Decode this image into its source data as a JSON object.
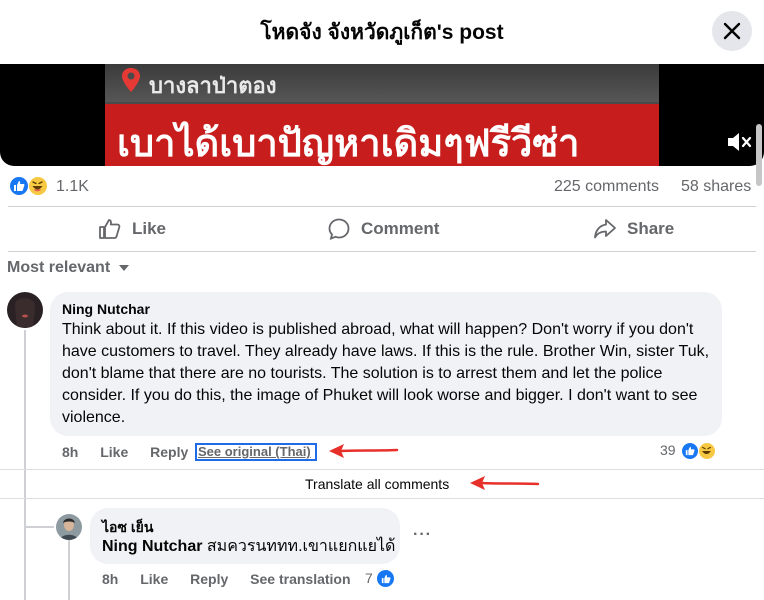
{
  "header": {
    "title": "โหดจัง จังหวัดภูเก็ต's post",
    "close_icon": "close-icon"
  },
  "video": {
    "location_text": "บางลาป่าตอง",
    "caption": "เบาได้เบาปัญหาเดิมๆฟรีวีซ่า",
    "mute_icon": "volume-muted-icon"
  },
  "stats": {
    "reactions": "1.1K",
    "comments": "225 comments",
    "shares": "58 shares"
  },
  "actions": {
    "like": "Like",
    "comment": "Comment",
    "share": "Share"
  },
  "sort": {
    "label": "Most relevant"
  },
  "comment1": {
    "author": "Ning Nutchar",
    "text": "Think about it. If this video is published abroad, what will happen? Don't worry if you don't have customers to travel. They already have laws. If this is the rule. Brother Win, sister Tuk, don't blame that there are no tourists. The solution is to arrest them and let the police consider. If you do this, the image of Phuket will look worse and bigger. I don't want to see violence.",
    "time": "8h",
    "like": "Like",
    "reply": "Reply",
    "see_original": "See original (Thai)",
    "reaction_count": "39"
  },
  "translate_all": "Translate all comments",
  "reply1": {
    "author": "ไอซ เย็น",
    "mention": "Ning Nutchar",
    "text": " สมควรนททท.เขาแยกแยได้",
    "time": "8h",
    "like": "Like",
    "reply": "Reply",
    "see_translation": "See translation",
    "reaction_count": "7",
    "more": "···"
  },
  "colors": {
    "accent": "#1877f2",
    "annotation_arrow": "#e8302a",
    "highlight_box": "#1d6be5"
  }
}
